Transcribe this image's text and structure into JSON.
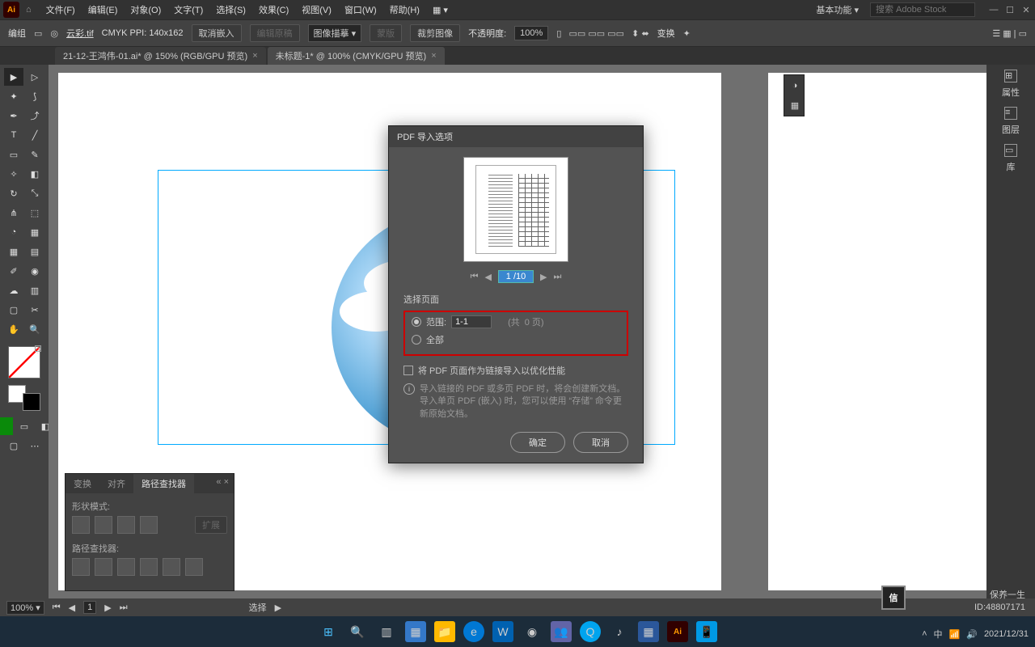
{
  "menubar": {
    "items": [
      "文件(F)",
      "编辑(E)",
      "对象(O)",
      "文字(T)",
      "选择(S)",
      "效果(C)",
      "视图(V)",
      "窗口(W)",
      "帮助(H)"
    ]
  },
  "workspace": {
    "label": "基本功能"
  },
  "search": {
    "placeholder": "搜索 Adobe Stock"
  },
  "control": {
    "group": "编组",
    "filename": "云彩.tif",
    "colormode": "CMYK PPI: 140x162",
    "cancel_embed": "取消嵌入",
    "edit_orig": "编辑原稿",
    "img_trace": "图像描摹",
    "mask": "蒙版",
    "crop": "裁剪图像",
    "opacity_label": "不透明度:",
    "opacity": "100%",
    "transform": "变换"
  },
  "tabs": [
    {
      "label": "21-12-王鸿伟-01.ai* @ 150% (RGB/GPU 预览)",
      "active": false
    },
    {
      "label": "未标题-1* @ 100% (CMYK/GPU 预览)",
      "active": true
    }
  ],
  "dock": {
    "props": "属性",
    "layers": "图层",
    "libs": "库"
  },
  "pathpanel": {
    "tab1": "变换",
    "tab2": "对齐",
    "tab3": "路径查找器",
    "shape": "形状模式:",
    "expand": "扩展",
    "finder": "路径查找器:"
  },
  "status": {
    "zoom": "100%",
    "page": "1",
    "select": "选择"
  },
  "dialog": {
    "title": "PDF 导入选项",
    "page_input": "1 /10",
    "section": "选择页面",
    "range_label": "范围:",
    "range_value": "1-1",
    "range_suffix_a": "(共",
    "range_suffix_b": "0 页)",
    "all_label": "全部",
    "link_opt": "将 PDF 页面作为链接导入以优化性能",
    "info1": "导入链接的 PDF 或多页 PDF 时，将会创建新文档。",
    "info2": "导入单页 PDF (嵌入) 时，您可以使用 “存储” 命令更新原始文档。",
    "ok": "确定",
    "cancel": "取消"
  },
  "watermark": {
    "brand": "保养一生",
    "id": "ID:48807171"
  },
  "tray": {
    "lang": "中",
    "date": "2021/12/31"
  }
}
